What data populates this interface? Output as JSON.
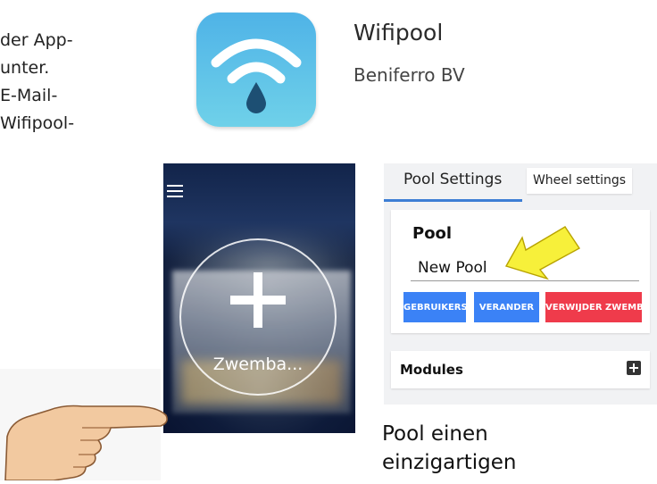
{
  "intro": {
    "lines": [
      "der App-",
      "unter.",
      "E-Mail-",
      "Wifipool-"
    ]
  },
  "app": {
    "name": "Wifipool",
    "developer": "Beniferro BV",
    "icon": "wifi-drop-icon",
    "icon_color": "#5ec3e8"
  },
  "phone": {
    "menu_icon": "hamburger-icon",
    "add_icon": "plus-icon",
    "add_label": "Zwemba..."
  },
  "settings": {
    "tabs": [
      {
        "label": "Pool Settings",
        "active": true
      },
      {
        "label": "Wheel settings",
        "active": false
      }
    ],
    "pool_card": {
      "title": "Pool",
      "name_value": "New Pool",
      "buttons": [
        {
          "label": "GEBRUIKERS",
          "color": "#3b82f6"
        },
        {
          "label": "VERANDER",
          "color": "#3b82f6"
        },
        {
          "label": "VERWIJDER ZWEMBAD",
          "color": "#ef3b4b"
        }
      ]
    },
    "modules": {
      "label": "Modules",
      "add_icon": "plus-square-icon"
    },
    "accent_color": "#3d7ed4"
  },
  "annotation_arrow_color": "#f7f03a",
  "outro": {
    "lines": [
      "Pool einen",
      "einzigartigen"
    ]
  }
}
